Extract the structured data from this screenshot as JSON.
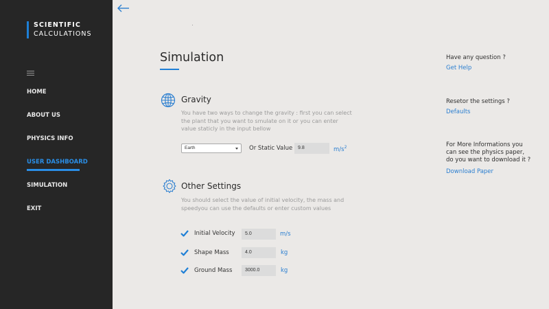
{
  "sidebar": {
    "logo_line1": "SCIENTIFIC",
    "logo_line2": "CALCULATIONS",
    "menu_icon": "hamburger-icon",
    "items": [
      {
        "label": "HOME"
      },
      {
        "label": "ABOUT US"
      },
      {
        "label": "PHYSICS INFO"
      },
      {
        "label": "USER DASHBOARD",
        "active": true
      },
      {
        "label": "SIMULATION"
      },
      {
        "label": "EXIT"
      }
    ]
  },
  "header": {
    "back_icon": "arrow-left-icon"
  },
  "main": {
    "title": "Simulation",
    "gravity": {
      "icon": "globe-icon",
      "title": "Gravity",
      "description": "You have two ways to change the gravity : first you can select the plant that you want to smulate on it or you can enter value staticly in the input bellow",
      "planet_selected": "Earth",
      "static_label": "Or Static Value",
      "static_value": "9.8",
      "unit": "m/s",
      "unit_exp": "2"
    },
    "other": {
      "icon": "gear-icon",
      "title": "Other Settings",
      "description": "You should select the value of initial velocity, the mass and speedyou can use the defaults or enter custom values",
      "rows": [
        {
          "label": "Initial Velocity",
          "value": "5.0",
          "unit": "m/s",
          "checked": true
        },
        {
          "label": "Shape Mass",
          "value": "4.0",
          "unit": "kg",
          "checked": true
        },
        {
          "label": "Ground Mass",
          "value": "3000.0",
          "unit": "kg",
          "checked": true
        }
      ]
    }
  },
  "aside": {
    "help_q": "Have any question ?",
    "help_link": "Get Help",
    "reset_q": "Resetor the settings ?",
    "reset_link": "Defaults",
    "download_q": "For More Informations you can see the physics paper, do you want to download it ?",
    "download_link": "Download Paper"
  },
  "colors": {
    "accent": "#1e7fd6",
    "sidebar_bg": "#262626",
    "page_bg": "#ebe9e7"
  }
}
